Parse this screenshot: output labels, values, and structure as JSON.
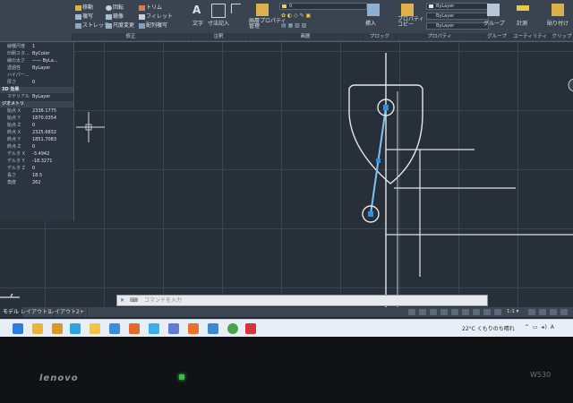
{
  "ribbon": {
    "modify_items": [
      "移動",
      "複写",
      "ストレッチ",
      "回転",
      "鏡像",
      "尺度変更",
      "トリム",
      "フィレット",
      "配列複写"
    ],
    "panel_modify": "修正",
    "text_label": "文字",
    "dimension_label": "寸法記入",
    "panel_annotation": "注釈",
    "layer_props_label": "画層プロパティ\n管理",
    "layer_value": "0",
    "panel_layers": "画層",
    "insert_label": "挿入",
    "panel_block": "ブロック",
    "properties_match_label": "プロパティ\nコピー",
    "bylayer_1": "ByLayer",
    "bylayer_2": "ByLayer",
    "bylayer_3": "ByLayer",
    "panel_properties": "プロパティ",
    "group_label": "グループ",
    "panel_groups": "グループ",
    "measure_label": "計測",
    "panel_utilities": "ユーティリティ",
    "clipboard_label": "貼り付け",
    "panel_clipboard": "クリップボード"
  },
  "properties": {
    "rows_top": [
      {
        "k": "線種尺度",
        "v": "1"
      },
      {
        "k": "印刷スタ...",
        "v": "ByColor"
      },
      {
        "k": "線の太さ",
        "v": "—— ByLa..."
      },
      {
        "k": "透過性",
        "v": "ByLayer"
      },
      {
        "k": "ハイパー...",
        "v": ""
      },
      {
        "k": "厚さ",
        "v": "0"
      }
    ],
    "section_3d": "3D 効果",
    "material": {
      "k": "マテリアル",
      "v": "ByLayer"
    },
    "section_geometry": "ジオメトリ",
    "rows_geo": [
      {
        "k": "始点 X",
        "v": "2338.1775"
      },
      {
        "k": "始点 Y",
        "v": "1870.0354"
      },
      {
        "k": "始点 Z",
        "v": "0"
      },
      {
        "k": "終点 X",
        "v": "2325.6832"
      },
      {
        "k": "終点 Y",
        "v": "1851.7083"
      },
      {
        "k": "終点 Z",
        "v": "0"
      },
      {
        "k": "デルタ X",
        "v": "-3.4942"
      },
      {
        "k": "デルタ Y",
        "v": "-18.3271"
      },
      {
        "k": "デルタ Z",
        "v": "0"
      },
      {
        "k": "長さ",
        "v": "18.5"
      },
      {
        "k": "角度",
        "v": "262"
      }
    ]
  },
  "command": {
    "close": "✕",
    "key": "⌨",
    "placeholder": "コマンドを入力"
  },
  "tabs": [
    "モデル",
    "レイアウト1",
    "レイアウト2",
    "+"
  ],
  "status": {
    "scale": "1:1 ▾"
  },
  "taskbar": {
    "weather": "22°C くもりのち晴れ",
    "tray": "^ ▭ ◂) A"
  },
  "bezel": {
    "brand": "lenovo",
    "model": "W530"
  },
  "colors": {
    "accent": "#4aa3df",
    "canvas": "#273039",
    "ribbon": "#3a4350",
    "taskbar": "#e8eef6",
    "autocad_red": "#d6333b"
  }
}
